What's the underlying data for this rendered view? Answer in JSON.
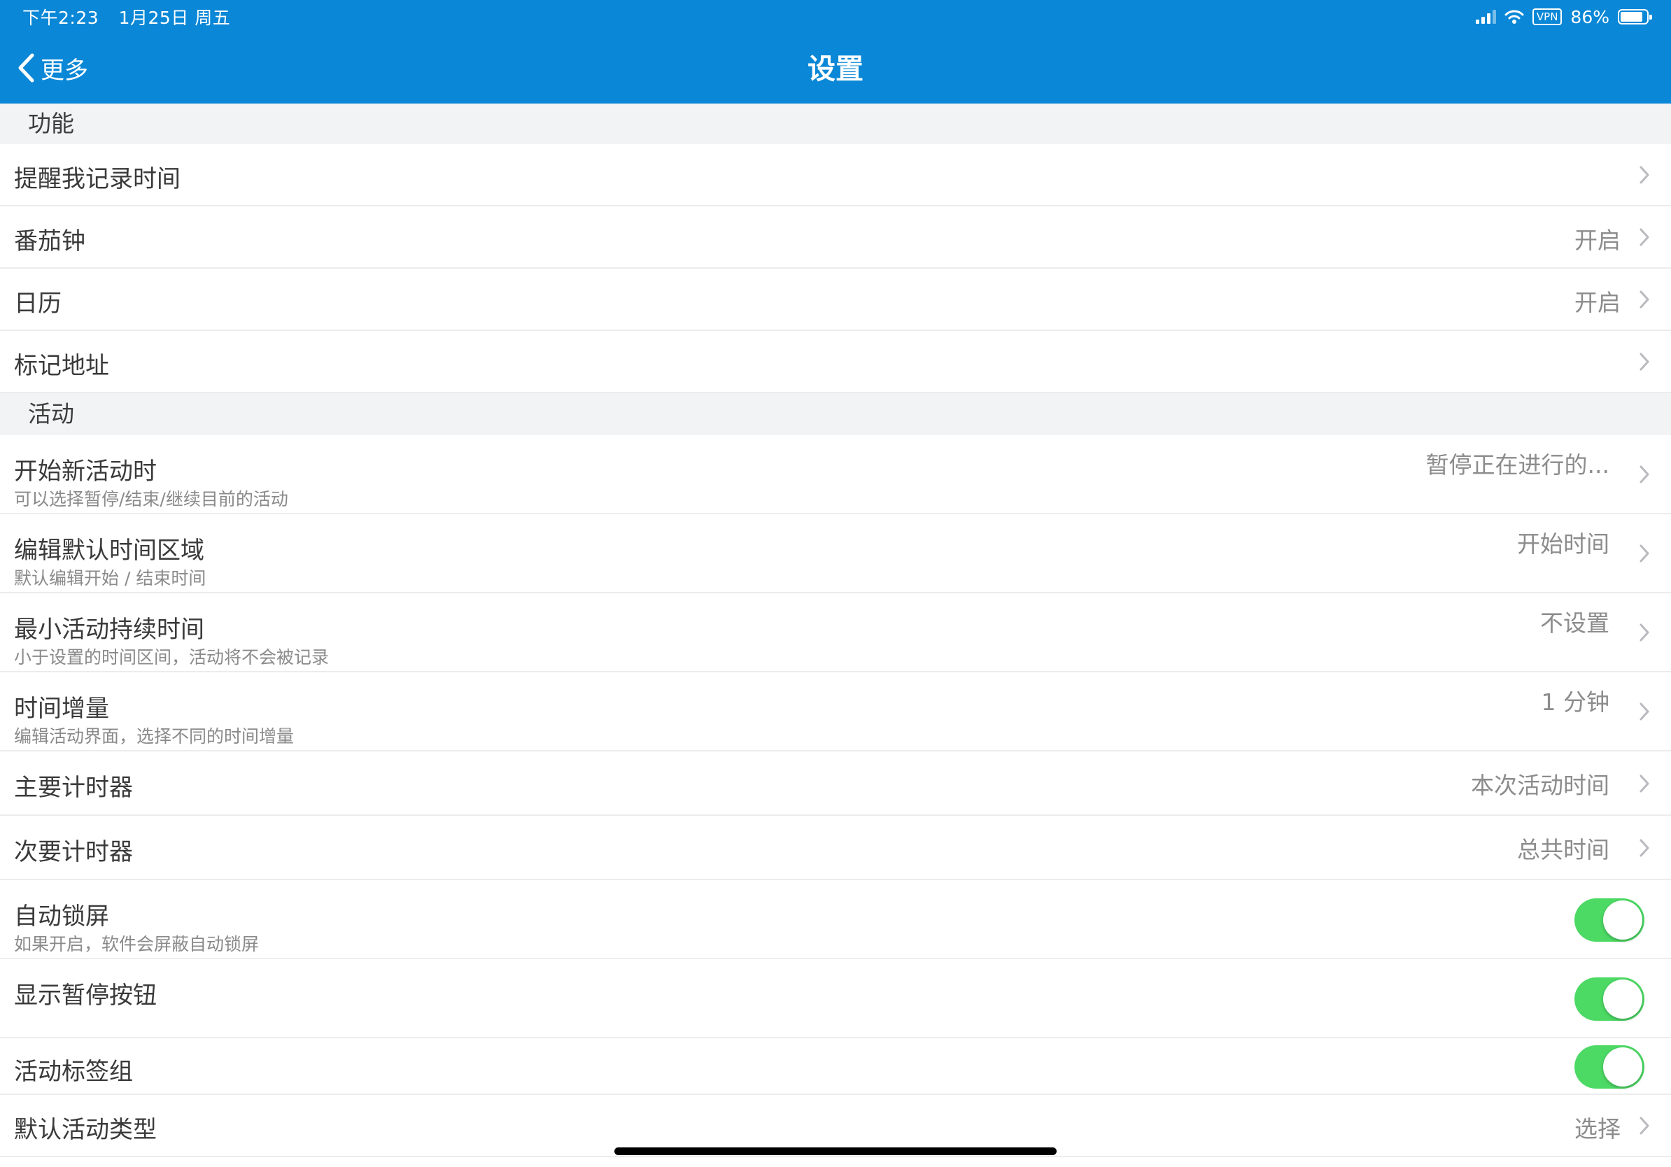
{
  "status_bar": {
    "time": "下午2:23",
    "date": "1月25日 周五",
    "vpn": "VPN",
    "battery": "86%",
    "battery_level": 0.86
  },
  "nav": {
    "back_label": "更多",
    "title": "设置"
  },
  "colors": {
    "header": "#0a87d6",
    "toggle_on": "#4cd964",
    "section_bg": "#f2f3f5"
  },
  "sections": {
    "features": {
      "header": "功能",
      "rows": [
        {
          "title": "提醒我记录时间",
          "value": ""
        },
        {
          "title": "番茄钟",
          "value": "开启"
        },
        {
          "title": "日历",
          "value": "开启"
        },
        {
          "title": "标记地址",
          "value": ""
        }
      ]
    },
    "activity": {
      "header": "活动",
      "rows": [
        {
          "title": "开始新活动时",
          "subtitle": "可以选择暂停/结束/继续目前的活动",
          "value": "暂停正在进行的..."
        },
        {
          "title": "编辑默认时间区域",
          "subtitle": "默认编辑开始 / 结束时间",
          "value": "开始时间"
        },
        {
          "title": "最小活动持续时间",
          "subtitle": "小于设置的时间区间，活动将不会被记录",
          "value": "不设置"
        },
        {
          "title": "时间增量",
          "subtitle": "编辑活动界面，选择不同的时间增量",
          "value": "1 分钟"
        },
        {
          "title": "主要计时器",
          "value": "本次活动时间"
        },
        {
          "title": "次要计时器",
          "value": "总共时间"
        },
        {
          "title": "自动锁屏",
          "subtitle": "如果开启，软件会屏蔽自动锁屏",
          "toggle": true
        },
        {
          "title": "显示暂停按钮",
          "toggle": true
        },
        {
          "title": "活动标签组",
          "toggle": true
        },
        {
          "title": "默认活动类型",
          "value": "选择"
        }
      ]
    }
  }
}
